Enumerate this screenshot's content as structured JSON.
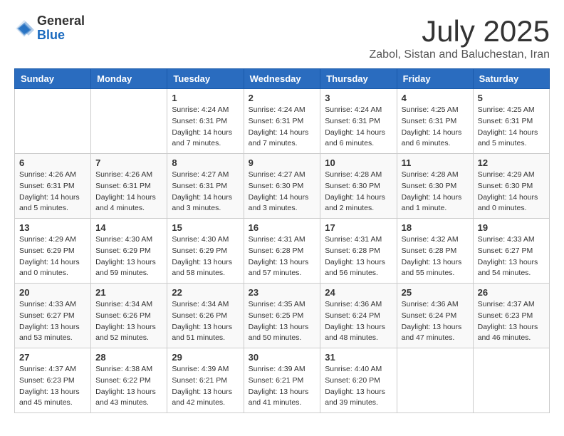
{
  "logo": {
    "general": "General",
    "blue": "Blue"
  },
  "title": "July 2025",
  "location": "Zabol, Sistan and Baluchestan, Iran",
  "days_of_week": [
    "Sunday",
    "Monday",
    "Tuesday",
    "Wednesday",
    "Thursday",
    "Friday",
    "Saturday"
  ],
  "weeks": [
    [
      {
        "day": "",
        "info": ""
      },
      {
        "day": "",
        "info": ""
      },
      {
        "day": "1",
        "info": "Sunrise: 4:24 AM\nSunset: 6:31 PM\nDaylight: 14 hours and 7 minutes."
      },
      {
        "day": "2",
        "info": "Sunrise: 4:24 AM\nSunset: 6:31 PM\nDaylight: 14 hours and 7 minutes."
      },
      {
        "day": "3",
        "info": "Sunrise: 4:24 AM\nSunset: 6:31 PM\nDaylight: 14 hours and 6 minutes."
      },
      {
        "day": "4",
        "info": "Sunrise: 4:25 AM\nSunset: 6:31 PM\nDaylight: 14 hours and 6 minutes."
      },
      {
        "day": "5",
        "info": "Sunrise: 4:25 AM\nSunset: 6:31 PM\nDaylight: 14 hours and 5 minutes."
      }
    ],
    [
      {
        "day": "6",
        "info": "Sunrise: 4:26 AM\nSunset: 6:31 PM\nDaylight: 14 hours and 5 minutes."
      },
      {
        "day": "7",
        "info": "Sunrise: 4:26 AM\nSunset: 6:31 PM\nDaylight: 14 hours and 4 minutes."
      },
      {
        "day": "8",
        "info": "Sunrise: 4:27 AM\nSunset: 6:31 PM\nDaylight: 14 hours and 3 minutes."
      },
      {
        "day": "9",
        "info": "Sunrise: 4:27 AM\nSunset: 6:30 PM\nDaylight: 14 hours and 3 minutes."
      },
      {
        "day": "10",
        "info": "Sunrise: 4:28 AM\nSunset: 6:30 PM\nDaylight: 14 hours and 2 minutes."
      },
      {
        "day": "11",
        "info": "Sunrise: 4:28 AM\nSunset: 6:30 PM\nDaylight: 14 hours and 1 minute."
      },
      {
        "day": "12",
        "info": "Sunrise: 4:29 AM\nSunset: 6:30 PM\nDaylight: 14 hours and 0 minutes."
      }
    ],
    [
      {
        "day": "13",
        "info": "Sunrise: 4:29 AM\nSunset: 6:29 PM\nDaylight: 14 hours and 0 minutes."
      },
      {
        "day": "14",
        "info": "Sunrise: 4:30 AM\nSunset: 6:29 PM\nDaylight: 13 hours and 59 minutes."
      },
      {
        "day": "15",
        "info": "Sunrise: 4:30 AM\nSunset: 6:29 PM\nDaylight: 13 hours and 58 minutes."
      },
      {
        "day": "16",
        "info": "Sunrise: 4:31 AM\nSunset: 6:28 PM\nDaylight: 13 hours and 57 minutes."
      },
      {
        "day": "17",
        "info": "Sunrise: 4:31 AM\nSunset: 6:28 PM\nDaylight: 13 hours and 56 minutes."
      },
      {
        "day": "18",
        "info": "Sunrise: 4:32 AM\nSunset: 6:28 PM\nDaylight: 13 hours and 55 minutes."
      },
      {
        "day": "19",
        "info": "Sunrise: 4:33 AM\nSunset: 6:27 PM\nDaylight: 13 hours and 54 minutes."
      }
    ],
    [
      {
        "day": "20",
        "info": "Sunrise: 4:33 AM\nSunset: 6:27 PM\nDaylight: 13 hours and 53 minutes."
      },
      {
        "day": "21",
        "info": "Sunrise: 4:34 AM\nSunset: 6:26 PM\nDaylight: 13 hours and 52 minutes."
      },
      {
        "day": "22",
        "info": "Sunrise: 4:34 AM\nSunset: 6:26 PM\nDaylight: 13 hours and 51 minutes."
      },
      {
        "day": "23",
        "info": "Sunrise: 4:35 AM\nSunset: 6:25 PM\nDaylight: 13 hours and 50 minutes."
      },
      {
        "day": "24",
        "info": "Sunrise: 4:36 AM\nSunset: 6:24 PM\nDaylight: 13 hours and 48 minutes."
      },
      {
        "day": "25",
        "info": "Sunrise: 4:36 AM\nSunset: 6:24 PM\nDaylight: 13 hours and 47 minutes."
      },
      {
        "day": "26",
        "info": "Sunrise: 4:37 AM\nSunset: 6:23 PM\nDaylight: 13 hours and 46 minutes."
      }
    ],
    [
      {
        "day": "27",
        "info": "Sunrise: 4:37 AM\nSunset: 6:23 PM\nDaylight: 13 hours and 45 minutes."
      },
      {
        "day": "28",
        "info": "Sunrise: 4:38 AM\nSunset: 6:22 PM\nDaylight: 13 hours and 43 minutes."
      },
      {
        "day": "29",
        "info": "Sunrise: 4:39 AM\nSunset: 6:21 PM\nDaylight: 13 hours and 42 minutes."
      },
      {
        "day": "30",
        "info": "Sunrise: 4:39 AM\nSunset: 6:21 PM\nDaylight: 13 hours and 41 minutes."
      },
      {
        "day": "31",
        "info": "Sunrise: 4:40 AM\nSunset: 6:20 PM\nDaylight: 13 hours and 39 minutes."
      },
      {
        "day": "",
        "info": ""
      },
      {
        "day": "",
        "info": ""
      }
    ]
  ]
}
